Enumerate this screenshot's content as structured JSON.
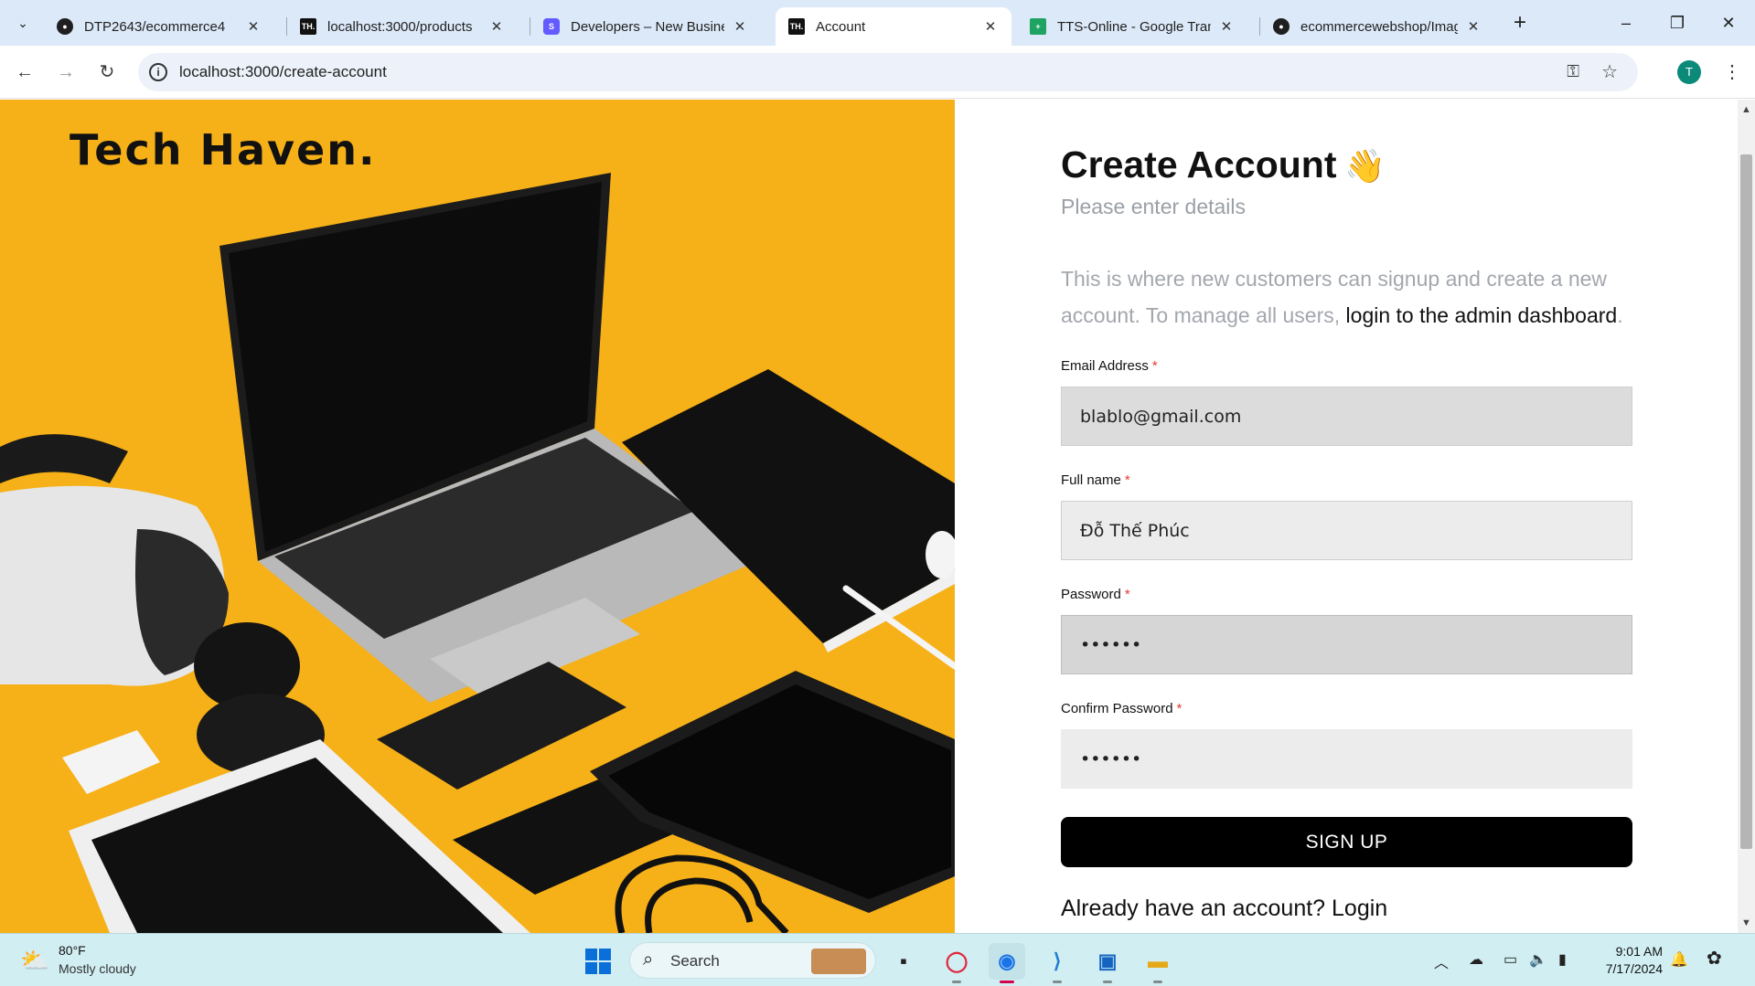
{
  "browser": {
    "tabs": [
      {
        "label": "DTP2643/ecommerce4",
        "favicon": "github-icon",
        "active": false
      },
      {
        "label": "localhost:3000/products",
        "favicon": "tech-haven-icon",
        "active": false
      },
      {
        "label": "Developers – New Business",
        "favicon": "stripe-icon",
        "active": false
      },
      {
        "label": "Account",
        "favicon": "tech-haven-icon",
        "active": true
      },
      {
        "label": "TTS-Online - Google Trang",
        "favicon": "sheets-icon",
        "active": false
      },
      {
        "label": "ecommercewebshop/Imag",
        "favicon": "github-icon",
        "active": false
      }
    ],
    "favicon_text": {
      "tech_haven": "TH.",
      "stripe": "S"
    },
    "url": "localhost:3000/create-account",
    "profile_initial": "T"
  },
  "page": {
    "brand": "Tech Haven.",
    "title": "Create Account",
    "title_emoji": "👋",
    "subtitle": "Please enter details",
    "intro_text": "This is where new customers can signup and create a new account. To manage all users,",
    "intro_link": "login to the admin dashboard",
    "intro_end": ".",
    "required_mark": "*",
    "fields": {
      "email": {
        "label": "Email Address",
        "value": "blablo@gmail.com"
      },
      "full_name": {
        "label": "Full name",
        "value": "Đỗ Thế Phúc"
      },
      "password": {
        "label": "Password",
        "value": "••••••"
      },
      "confirm_password": {
        "label": "Confirm Password",
        "value": "••••••"
      }
    },
    "signup_button": "SIGN UP",
    "login_prompt": "Already have an account? Login"
  },
  "taskbar": {
    "weather_temp": "80°F",
    "weather_desc": "Mostly cloudy",
    "search_placeholder": "Search",
    "time": "9:01 AM",
    "date": "7/17/2024"
  },
  "colors": {
    "hero_background": "#f6b018",
    "signup_button": "#000000",
    "active_tab": "#ffffff",
    "tabstrip": "#dce9f8"
  }
}
